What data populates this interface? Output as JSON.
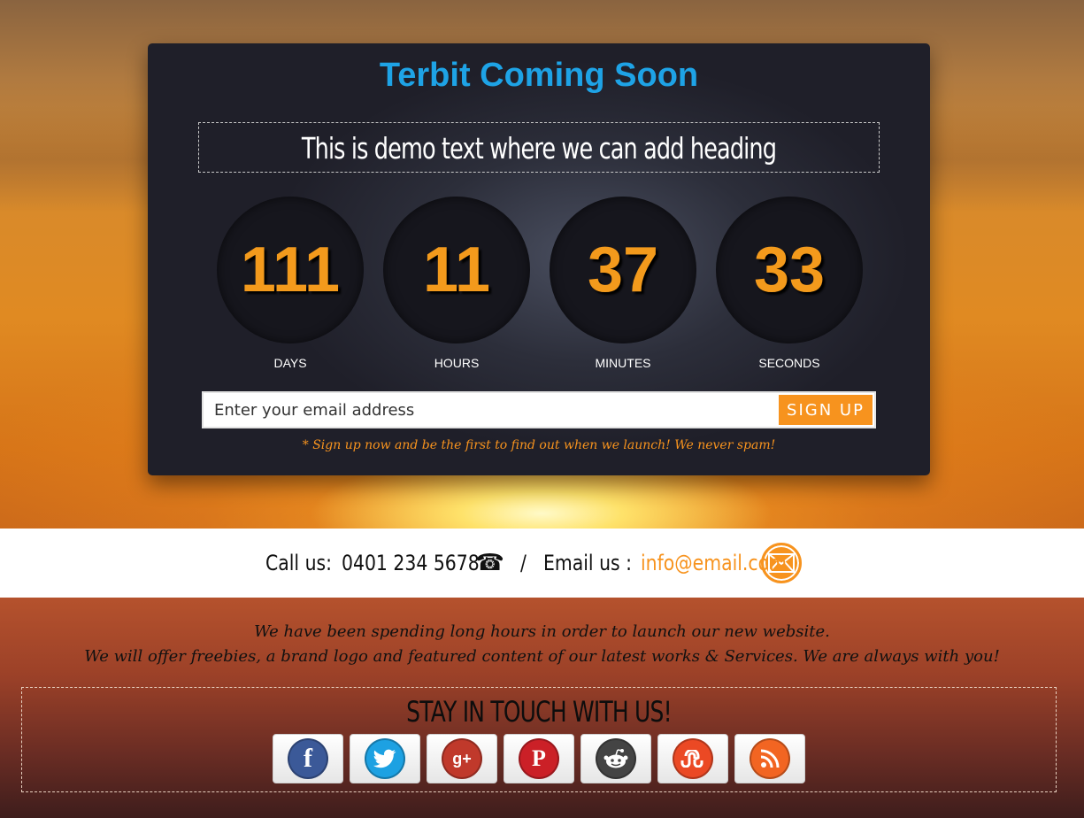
{
  "site_title": "Terbit Coming Soon",
  "heading": "This is demo text where we can add heading",
  "countdown": [
    {
      "value": "111",
      "label": "DAYS"
    },
    {
      "value": "11",
      "label": "HOURS"
    },
    {
      "value": "37",
      "label": "MINUTES"
    },
    {
      "value": "33",
      "label": "SECONDS"
    }
  ],
  "signup": {
    "placeholder": "Enter your email address",
    "button_label": "SIGN UP",
    "note": "* Sign up now and be the first to find out when we launch! We never spam!"
  },
  "contact": {
    "call_label": "Call us:",
    "phone": "0401 234 5678",
    "separator": "/",
    "email_label": "Email us :",
    "email": "info@email.com"
  },
  "tagline": {
    "line1": "We have been spending long hours in order to launch our new website.",
    "line2": "We will offer freebies, a brand logo and featured content of our latest works & Services. We are always with you!"
  },
  "social": {
    "title": "STAY IN TOUCH WITH US!",
    "links": [
      {
        "icon": "facebook-icon",
        "glyph": "f",
        "color": "#3b5998"
      },
      {
        "icon": "twitter-icon",
        "glyph": "t",
        "color": "#1da1e2"
      },
      {
        "icon": "google-plus-icon",
        "glyph": "g+",
        "color": "#c0392b"
      },
      {
        "icon": "pinterest-icon",
        "glyph": "P",
        "color": "#cb2027"
      },
      {
        "icon": "reddit-icon",
        "glyph": "r",
        "color": "#444444"
      },
      {
        "icon": "stumbleupon-icon",
        "glyph": "su",
        "color": "#eb4924"
      },
      {
        "icon": "rss-icon",
        "glyph": "rss",
        "color": "#f26522"
      }
    ]
  },
  "colors": {
    "accent_orange": "#f7931e",
    "title_blue": "#1ea3e6",
    "panel_dark": "#1f1f29"
  }
}
